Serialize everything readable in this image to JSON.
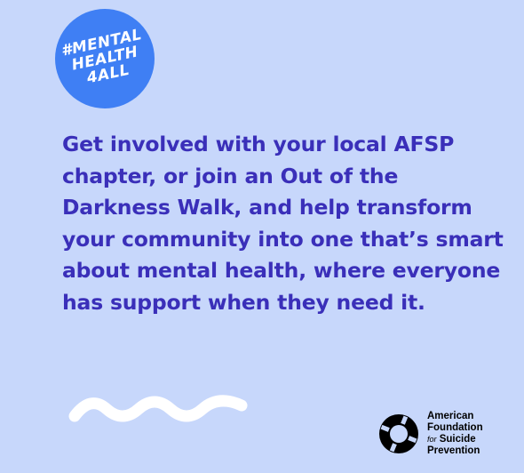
{
  "badge": {
    "text": "#MENTAL\nHEALTH\n4ALL",
    "color": "#3f7ff4"
  },
  "message": {
    "text": "Get involved with your local AFSP chapter, or join an Out of the Darkness Walk, and help transform your community into one that’s smart about mental health, where everyone has support when they need it.",
    "color": "#3a2fb9"
  },
  "decoration": {
    "wave_icon": "wavy-line-icon",
    "color": "#ffffff"
  },
  "logo": {
    "icon": "life-ring-icon",
    "line1": "American",
    "line2": "Foundation",
    "line3_prefix": "for",
    "line3_rest": "Suicide",
    "line4": "Prevention"
  },
  "colors": {
    "background": "#c7d7fb"
  }
}
